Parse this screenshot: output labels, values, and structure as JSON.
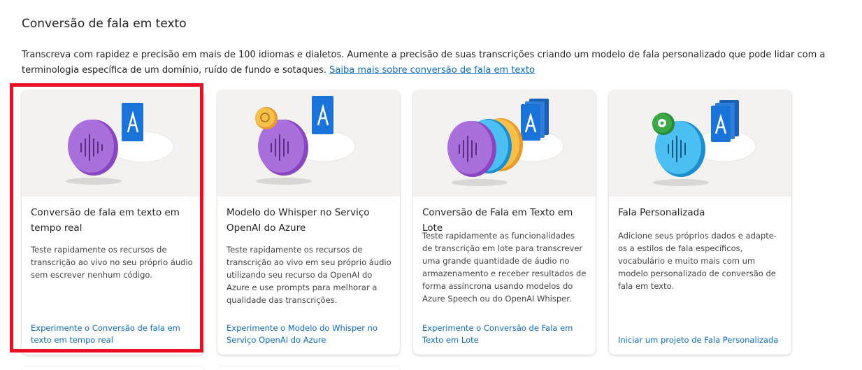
{
  "section": {
    "title": "Conversão de fala em texto",
    "description": "Transcreva com rapidez e precisão em mais de 100 idiomas e dialetos. Aumente a precisão de suas transcrições criando um modelo de fala personalizado que pode lidar com a terminologia específica de um domínio, ruído de fundo e sotaques.",
    "learn_more_link": "Saiba mais sobre conversão de fala em texto"
  },
  "cards": [
    {
      "title": "Conversão de fala em texto em tempo real",
      "description": "Teste rapidamente os recursos de transcrição ao vivo no seu próprio áudio sem escrever nenhum código.",
      "link": "Experimente o Conversão de fala em texto em tempo real",
      "illustration": "speech-to-text-illustration"
    },
    {
      "title": "Modelo do Whisper no Serviço OpenAI do Azure",
      "description": "Teste rapidamente os recursos de transcrição ao vivo em seu próprio áudio utilizando seu recurso da OpenAI do Azure e use prompts para melhorar a qualidade das transcrições.",
      "link": "Experimente o Modelo do Whisper no Serviço OpenAI do Azure",
      "illustration": "whisper-openai-illustration"
    },
    {
      "title": "Conversão de Fala em Texto em Lote",
      "description": "Teste rapidamente as funcionalidades de transcrição em lote para transcrever uma grande quantidade de áudio no armazenamento e receber resultados de forma assíncrona usando modelos do Azure Speech ou do OpenAI Whisper.",
      "link": "Experimente o Conversão de Fala em Texto em Lote",
      "illustration": "batch-transcription-illustration"
    },
    {
      "title": "Fala Personalizada",
      "description": "Adicione seus próprios dados e adapte-os a estilos de fala específicos, vocabulário e muito mais com um modelo personalizado de conversão de fala em texto.",
      "link": "Iniciar um projeto de Fala Personalizada",
      "illustration": "custom-speech-illustration"
    }
  ],
  "colors": {
    "link": "#0f6cbd",
    "highlight": "#e81123",
    "purple_disc": "#9b59d0",
    "blue_disc": "#2fa8e6",
    "orange_disc": "#f2b04a",
    "letter_tile": "#1a73d9",
    "gear_badge": "#3aa845"
  },
  "selected_card_index": 0
}
